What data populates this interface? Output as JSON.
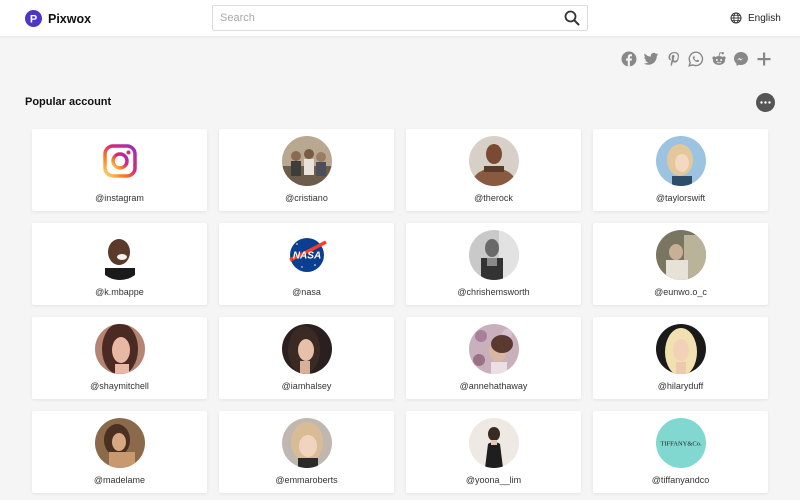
{
  "brand": {
    "name": "Pixwox",
    "logo_letter": "P",
    "color": "#4b36c9"
  },
  "search": {
    "placeholder": "Search",
    "value": ""
  },
  "language": {
    "label": "English"
  },
  "share_icons": [
    "facebook-icon",
    "twitter-icon",
    "pinterest-icon",
    "whatsapp-icon",
    "reddit-icon",
    "messenger-icon",
    "plus-icon"
  ],
  "section": {
    "title": "Popular account"
  },
  "accounts": [
    {
      "handle": "@instagram",
      "avatar": "instagram-logo"
    },
    {
      "handle": "@cristiano",
      "avatar": "photo"
    },
    {
      "handle": "@therock",
      "avatar": "photo"
    },
    {
      "handle": "@taylorswift",
      "avatar": "photo"
    },
    {
      "handle": "@k.mbappe",
      "avatar": "photo"
    },
    {
      "handle": "@nasa",
      "avatar": "nasa-logo"
    },
    {
      "handle": "@chrishemsworth",
      "avatar": "photo"
    },
    {
      "handle": "@eunwo.o_c",
      "avatar": "photo"
    },
    {
      "handle": "@shaymitchell",
      "avatar": "photo"
    },
    {
      "handle": "@iamhalsey",
      "avatar": "photo"
    },
    {
      "handle": "@annehathaway",
      "avatar": "photo"
    },
    {
      "handle": "@hilaryduff",
      "avatar": "photo"
    },
    {
      "handle": "@madelame",
      "avatar": "photo"
    },
    {
      "handle": "@emmaroberts",
      "avatar": "photo"
    },
    {
      "handle": "@yoona__lim",
      "avatar": "photo"
    },
    {
      "handle": "@tiffanyandco",
      "avatar": "tiffany-logo",
      "logo_text": "TIFFANY&Co."
    }
  ]
}
